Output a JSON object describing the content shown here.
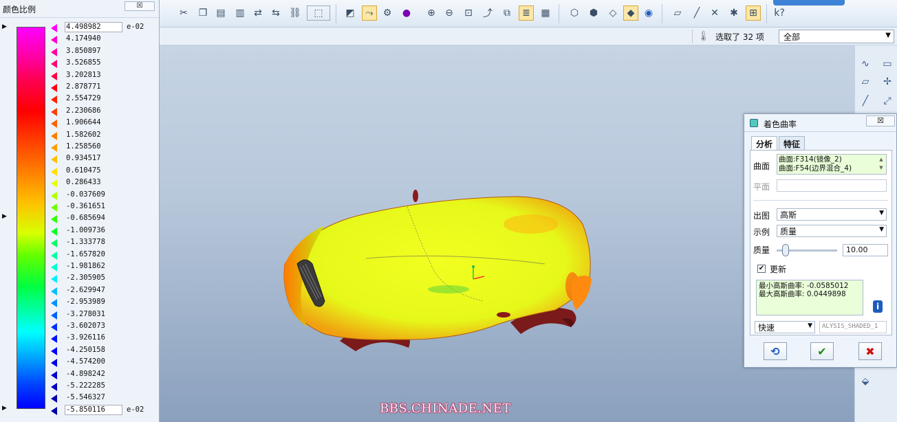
{
  "color_scale": {
    "title": "颜色比例",
    "close_label": "☒",
    "exponent": "e-02",
    "values": [
      "4.498982",
      "4.174940",
      "3.850897",
      "3.526855",
      "3.202813",
      "2.878771",
      "2.554729",
      "2.230686",
      "1.906644",
      "1.582602",
      "1.258560",
      "0.934517",
      "0.610475",
      "0.286433",
      "-0.037609",
      "-0.361651",
      "-0.685694",
      "-1.009736",
      "-1.333778",
      "-1.657820",
      "-1.981862",
      "-2.305905",
      "-2.629947",
      "-2.953989",
      "-3.278031",
      "-3.602073",
      "-3.926116",
      "-4.250158",
      "-4.574200",
      "-4.898242",
      "-5.222285",
      "-5.546327",
      "-5.850116"
    ],
    "marker_colors": [
      "#ff00ff",
      "#ff00d0",
      "#ff00a0",
      "#ff0070",
      "#ff0040",
      "#ff0010",
      "#ff2000",
      "#ff4000",
      "#ff6000",
      "#ff8000",
      "#ffa000",
      "#ffc000",
      "#ffe000",
      "#e8ff00",
      "#b0ff00",
      "#70ff00",
      "#30ff00",
      "#00ff20",
      "#00ff60",
      "#00ffa0",
      "#00ffd0",
      "#00f0ff",
      "#00c0ff",
      "#0090ff",
      "#0060ff",
      "#0030ff",
      "#0010ff",
      "#0000ff",
      "#0000e0",
      "#0000d0",
      "#0000c0",
      "#0000b0",
      "#0000a0"
    ]
  },
  "selection": {
    "selected_text": "选取了 32 项",
    "filter_value": "全部"
  },
  "watermark": "BBS.CHINADE.NET",
  "dialog": {
    "title": "着色曲率",
    "close_label": "☒",
    "tabs": [
      "分析",
      "特征"
    ],
    "surface_label": "曲面",
    "surface_items": [
      "曲面:F314(镜像_2)",
      "曲面:F54(边界混合_4)"
    ],
    "plane_label": "平面",
    "output_label": "出图",
    "output_value": "高斯",
    "display_label": "示例",
    "display_value": "质量",
    "quality_label": "质量",
    "quality_value": "10.00",
    "quality_level": 0.1,
    "update_label": "更新",
    "result_line1": "最小高斯曲率: -0.0585012",
    "result_line2": "最大高斯曲率: 0.0449898",
    "mode_value": "快速",
    "analysis_name": "ALYSIS_SHADED_1",
    "colors": {
      "accent": "#1e5bbd",
      "ok": "#1a8a1a",
      "cancel": "#d01010"
    }
  }
}
